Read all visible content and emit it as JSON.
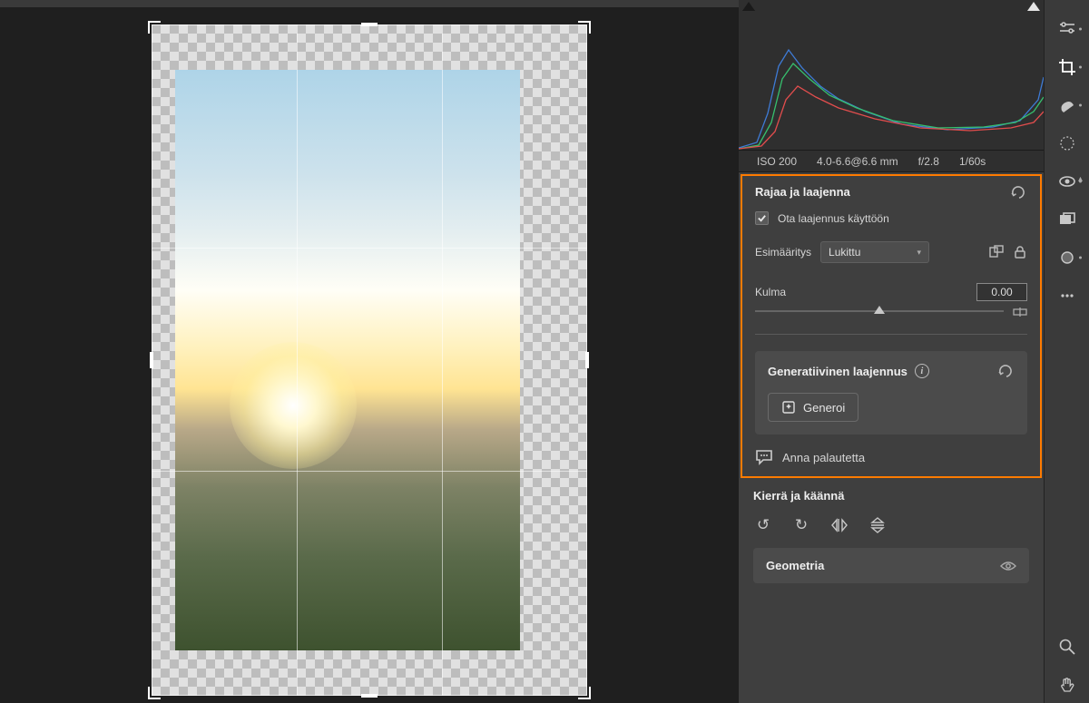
{
  "metadata": {
    "iso": "ISO 200",
    "lens": "4.0-6.6@6.6 mm",
    "aperture": "f/2.8",
    "shutter": "1/60s"
  },
  "crop_panel": {
    "title": "Rajaa ja laajenna",
    "enable_expand_label": "Ota laajennus käyttöön",
    "enable_expand_checked": true,
    "preset_label": "Esimääritys",
    "preset_value": "Lukittu",
    "angle_label": "Kulma",
    "angle_value": "0.00"
  },
  "generative": {
    "title": "Generatiivinen laajennus",
    "button_label": "Generoi"
  },
  "feedback": {
    "label": "Anna palautetta"
  },
  "rotate": {
    "title": "Kierrä ja käännä"
  },
  "geometry": {
    "title": "Geometria"
  },
  "toolbar_icons": {
    "sliders": "sliders-icon",
    "crop": "crop-icon",
    "heal": "heal-icon",
    "mask": "mask-icon",
    "redeye": "redeye-icon",
    "compare": "compare-icon",
    "blur": "blur-icon",
    "more": "more-icon",
    "zoom": "zoom-icon",
    "hand": "hand-icon"
  }
}
